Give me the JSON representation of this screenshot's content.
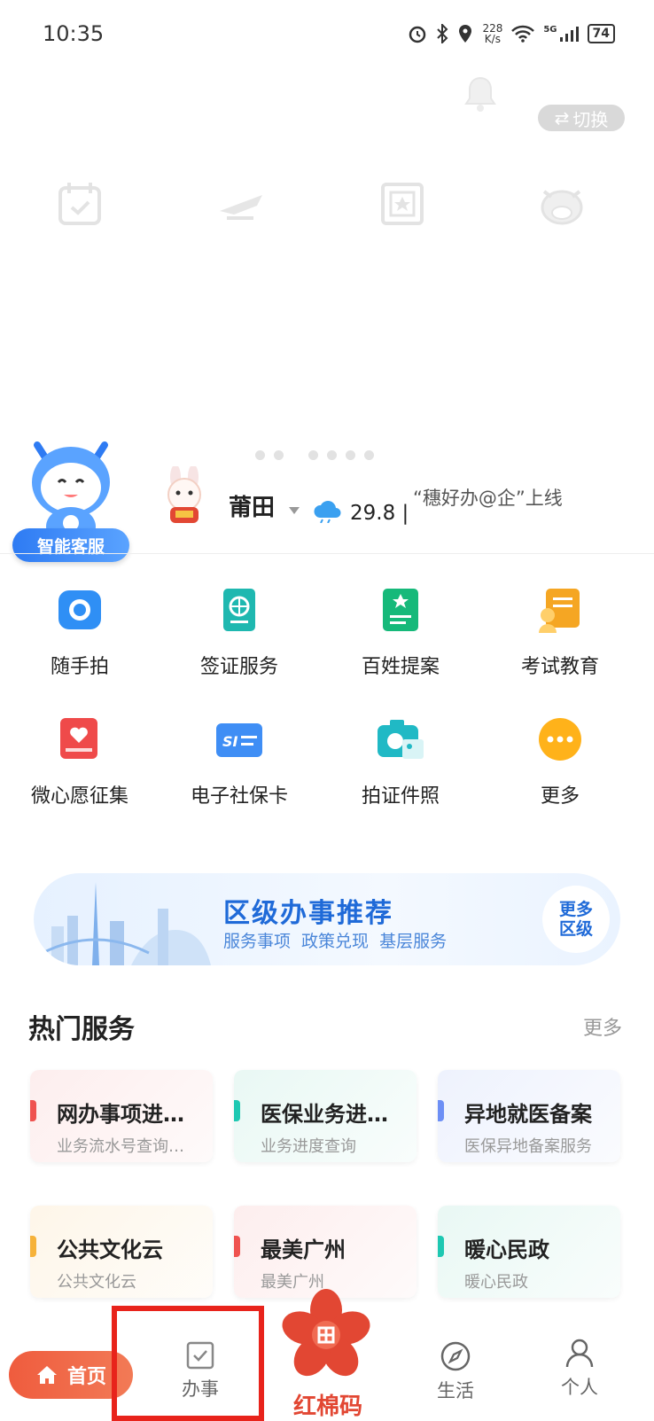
{
  "status_bar": {
    "time": "10:35",
    "net_speed_value": "228",
    "net_speed_unit": "K/s",
    "network": "5G",
    "battery": "74"
  },
  "header": {
    "switch_label": "切换",
    "quick_icons": [
      "calendar-icon",
      "airplane-icon",
      "certificate-icon",
      "ox-mascot-icon"
    ],
    "carousel_dots": 6,
    "carousel_active": 0
  },
  "assistant": {
    "label": "智能客服"
  },
  "location": {
    "city": "莆田",
    "temperature": "29.8",
    "notice": "“穗好办@企”上线"
  },
  "grid": [
    {
      "label": "随手拍",
      "icon": "camera-icon",
      "color": "#2f8ff5"
    },
    {
      "label": "签证服务",
      "icon": "passport-icon",
      "color": "#1fb8b0"
    },
    {
      "label": "百姓提案",
      "icon": "proposal-icon",
      "color": "#16b97a"
    },
    {
      "label": "考试教育",
      "icon": "exam-icon",
      "color": "#f5a623"
    },
    {
      "label": "微心愿征集",
      "icon": "heart-card-icon",
      "color": "#ef4a4a"
    },
    {
      "label": "电子社保卡",
      "icon": "social-card-icon",
      "color": "#3f8ef5"
    },
    {
      "label": "拍证件照",
      "icon": "id-photo-icon",
      "color": "#20b9c5"
    },
    {
      "label": "更多",
      "icon": "more-icon",
      "color": "#ffb21a"
    }
  ],
  "banner": {
    "title": "区级办事推荐",
    "subtitle": "服务事项  政策兑现  基层服务",
    "more_line1": "更多",
    "more_line2": "区级"
  },
  "hot": {
    "title": "热门服务",
    "more": "更多",
    "cards": [
      {
        "title": "网办事项进…",
        "sub": "业务流水号查询…",
        "accent": "#ef5350",
        "bg": "#fdeeee"
      },
      {
        "title": "医保业务进…",
        "sub": "业务进度查询",
        "accent": "#1ec8b2",
        "bg": "#e9f8f4"
      },
      {
        "title": "异地就医备案",
        "sub": "医保异地备案服务",
        "accent": "#6d8ff5",
        "bg": "#eef2fd"
      },
      {
        "title": "公共文化云",
        "sub": "公共文化云",
        "accent": "#f6b23a",
        "bg": "#fef6e9"
      },
      {
        "title": "最美广州",
        "sub": "最美广州",
        "accent": "#ef5350",
        "bg": "#fdeeee"
      },
      {
        "title": "暖心民政",
        "sub": "暖心民政",
        "accent": "#1ec8b2",
        "bg": "#e9f8f4"
      }
    ]
  },
  "nav": {
    "home": "首页",
    "service": "办事",
    "center": "红棉码",
    "life": "生活",
    "me": "个人"
  },
  "colors": {
    "brand_red": "#e24733",
    "accent_blue": "#2e7bf3",
    "highlight_box": "#e8231b"
  }
}
